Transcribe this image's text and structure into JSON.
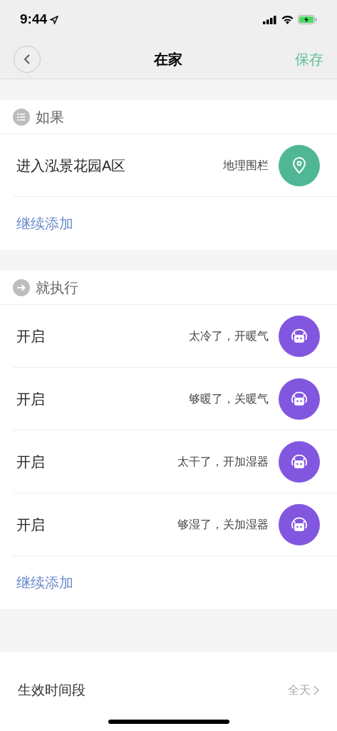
{
  "status_bar": {
    "time": "9:44"
  },
  "nav": {
    "title": "在家",
    "action": "保存"
  },
  "sections": [
    {
      "kind": "condition",
      "title": "如果",
      "rows": [
        {
          "label": "进入泓景花园A区",
          "detail": "地理围栏",
          "kind": "location"
        }
      ],
      "add": "继续添加"
    },
    {
      "kind": "action",
      "title": "就执行",
      "rows": [
        {
          "label": "开启",
          "detail": "太冷了，开暖气",
          "kind": "robot"
        },
        {
          "label": "开启",
          "detail": "够暖了，关暖气",
          "kind": "robot"
        },
        {
          "label": "开启",
          "detail": "太干了，开加湿器",
          "kind": "robot"
        },
        {
          "label": "开启",
          "detail": "够湿了，关加湿器",
          "kind": "robot"
        }
      ],
      "add": "继续添加"
    }
  ],
  "period": {
    "label": "生效时间段",
    "value": "全天"
  }
}
